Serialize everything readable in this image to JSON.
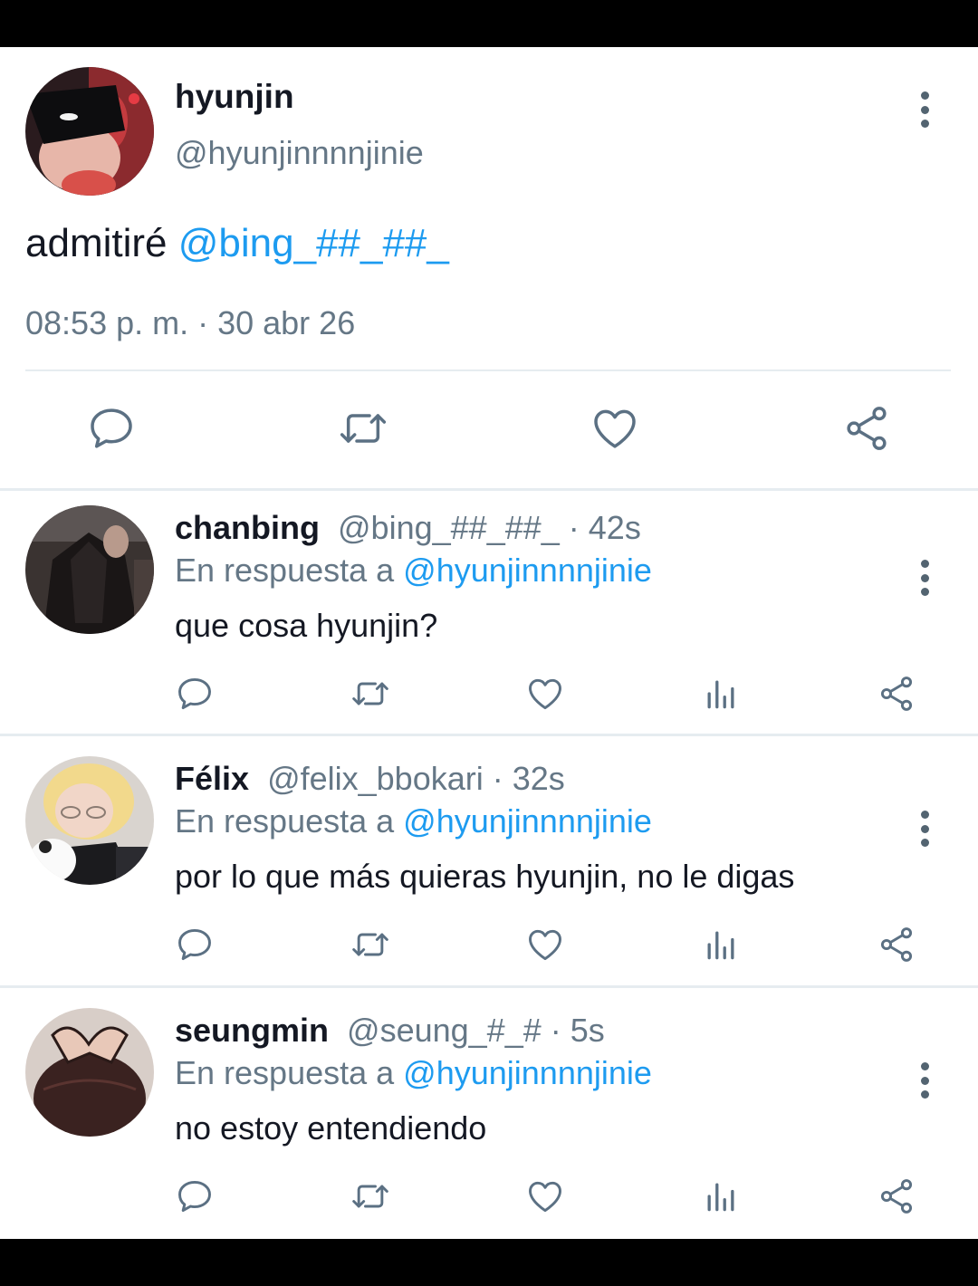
{
  "main_tweet": {
    "name": "hyunjin",
    "handle": "@hyunjinnnnjinie",
    "text": "admitiré ",
    "mention": "@bing_##_##_",
    "timestamp": "08:53 p. m. · 30 abr 26",
    "actions": [
      "reply-icon",
      "retweet-icon",
      "like-icon",
      "share-icon"
    ]
  },
  "replies": [
    {
      "name": "chanbing",
      "handle": "@bing_##_##_",
      "time": "· 42s",
      "reply_prefix": "En respuesta a ",
      "reply_to": "@hyunjinnnnjinie",
      "text": "que cosa hyunjin?"
    },
    {
      "name": "Félix",
      "handle": "@felix_bbokari",
      "time": "· 32s",
      "reply_prefix": "En respuesta a ",
      "reply_to": "@hyunjinnnnjinie",
      "text": "por lo que más quieras hyunjin, no le digas"
    },
    {
      "name": "seungmin",
      "handle": "@seung_#_#",
      "time": "· 5s",
      "reply_prefix": "En respuesta a ",
      "reply_to": "@hyunjinnnnjinie",
      "text": "no estoy entendiendo"
    }
  ],
  "reply_actions": [
    "reply-icon",
    "retweet-icon",
    "like-icon",
    "analytics-icon",
    "share-icon"
  ],
  "colors": {
    "accent": "#1d9bf0",
    "text_primary": "#141823",
    "text_secondary": "#657786",
    "icon": "#5b7083",
    "divider": "#e6ecf0"
  }
}
